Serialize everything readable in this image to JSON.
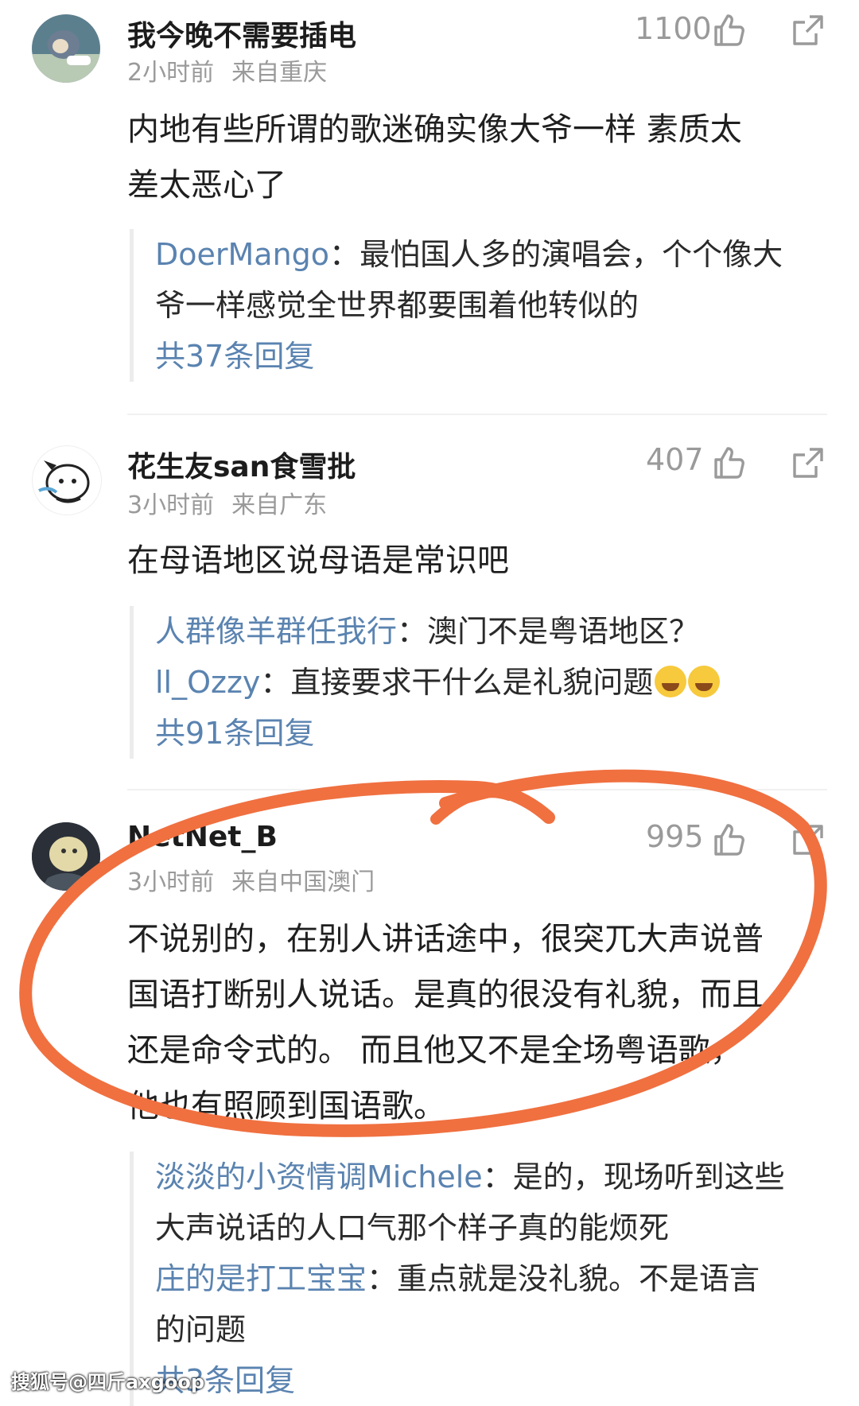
{
  "comments": [
    {
      "username": "我今晚不需要插电",
      "time": "2小时前",
      "location": "来自重庆",
      "likes": "1100",
      "text_lines": [
        "内地有些所谓的歌迷确实像大爷一样 素质太",
        "差太恶心了"
      ],
      "replies": [
        {
          "who": "DoerMango",
          "sep": "：",
          "text_lines": [
            "最怕国人多的演唱会，个个像大",
            "爷一样感觉全世界都要围着他转似的"
          ]
        }
      ],
      "more_label": "共37条回复"
    },
    {
      "username": "花生友san食雪批",
      "time": "3小时前",
      "location": "来自广东",
      "likes": "407",
      "text_lines": [
        "在母语地区说母语是常识吧"
      ],
      "replies": [
        {
          "who": "人群像羊群任我行",
          "sep": "：",
          "text_lines": [
            "澳门不是粤语地区？"
          ]
        },
        {
          "who": "ll_Ozzy",
          "sep": "：",
          "text_lines": [
            "直接要求干什么是礼貌问题"
          ],
          "emoji": true
        }
      ],
      "more_label": "共91条回复"
    },
    {
      "username": "NetNet_B",
      "time": "3小时前",
      "location": "来自中国澳门",
      "likes": "995",
      "text_lines": [
        "不说别的，在别人讲话途中，很突兀大声说普",
        "国语打断别人说话。是真的很没有礼貌，而且",
        "还是命令式的。 而且他又不是全场粤语歌，",
        "他也有照顾到国语歌。"
      ],
      "replies": [
        {
          "who": "淡淡的小资情调Michele",
          "sep": "：",
          "text_lines": [
            "是的，现场听到这些",
            "大声说话的人口气那个样子真的能烦死"
          ]
        },
        {
          "who": "庄的是打工宝宝",
          "sep": "：",
          "text_lines": [
            "重点就是没礼貌。不是语言",
            "的问题"
          ]
        }
      ],
      "more_label": "共3条回复"
    }
  ],
  "icons": {
    "like": "thumbs-up-icon",
    "share": "share-icon"
  },
  "colors": {
    "reply_name": "#5a83b0",
    "meta": "#9a9a9a",
    "annotation": "#f07040"
  },
  "watermark": "搜狐号@四斤axgoop"
}
